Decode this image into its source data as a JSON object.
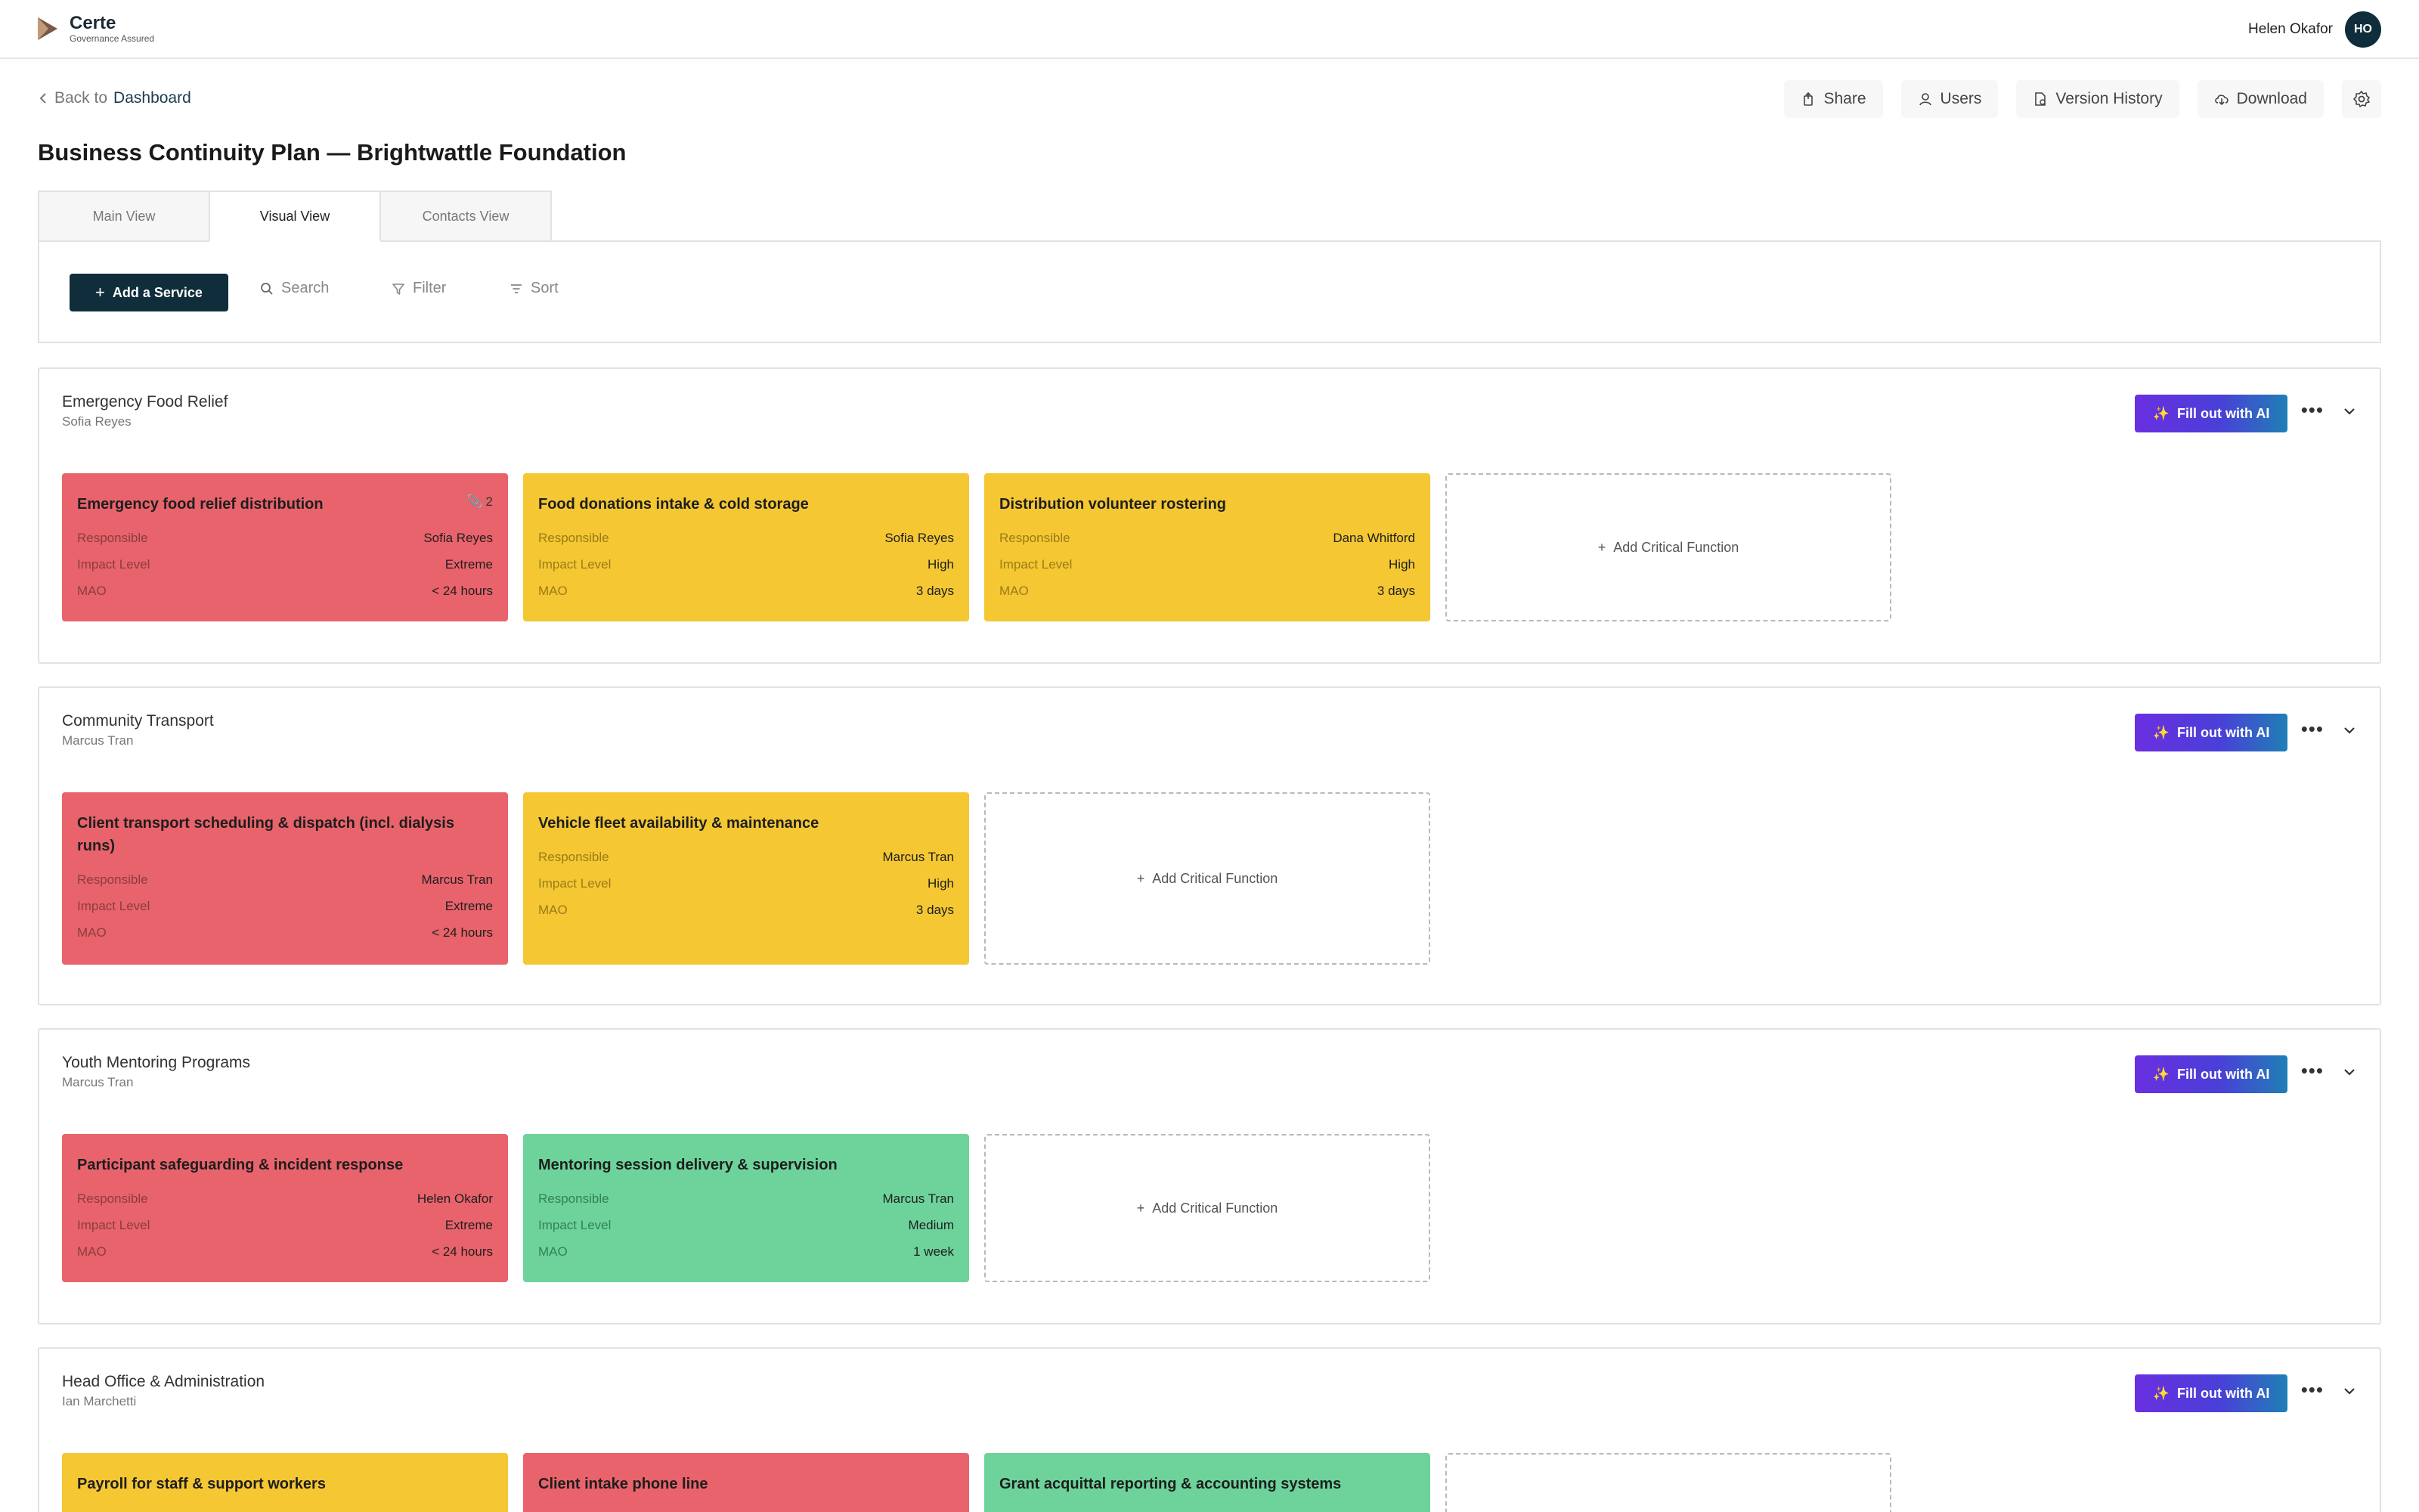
{
  "app": {
    "name": "Certe",
    "tagline": "Governance Assured"
  },
  "user": {
    "name": "Helen Okafor",
    "initials": "HO"
  },
  "nav": {
    "back_prefix": "Back to",
    "back_link": "Dashboard"
  },
  "actions": {
    "share": "Share",
    "users": "Users",
    "version_history": "Version History",
    "download": "Download",
    "settings_icon": "gear-icon"
  },
  "page": {
    "title": "Business Continuity Plan — Brightwattle Foundation"
  },
  "tabs": [
    {
      "label": "Main View"
    },
    {
      "label": "Visual View"
    },
    {
      "label": "Contacts View"
    }
  ],
  "active_tab": "Visual View",
  "toolbar": {
    "add_service": "Add a Service",
    "search": "Search",
    "filter": "Filter",
    "sort": "Sort"
  },
  "labels": {
    "responsible": "Responsible",
    "impact": "Impact Level",
    "mao": "MAO",
    "fill_ai": "Fill out with AI",
    "add_cf": "Add Critical Function"
  },
  "colors": {
    "extreme": "#e8636b",
    "high": "#f4c733",
    "medium": "#6dd39b",
    "primary": "#0f2d3a"
  },
  "services": [
    {
      "name": "Emergency Food Relief",
      "owner": "Sofia Reyes",
      "functions": [
        {
          "title": "Emergency food relief distribution",
          "attachments": "2",
          "responsible": "Sofia Reyes",
          "impact": "Extreme",
          "mao": "< 24 hours"
        },
        {
          "title": "Food donations intake & cold storage",
          "responsible": "Sofia Reyes",
          "impact": "High",
          "mao": "3 days"
        },
        {
          "title": "Distribution volunteer rostering",
          "responsible": "Dana Whitford",
          "impact": "High",
          "mao": "3 days"
        }
      ]
    },
    {
      "name": "Community Transport",
      "owner": "Marcus Tran",
      "functions": [
        {
          "title": "Client transport scheduling & dispatch (incl. dialysis runs)",
          "responsible": "Marcus Tran",
          "impact": "Extreme",
          "mao": "< 24 hours"
        },
        {
          "title": "Vehicle fleet availability & maintenance",
          "responsible": "Marcus Tran",
          "impact": "High",
          "mao": "3 days"
        }
      ]
    },
    {
      "name": "Youth Mentoring Programs",
      "owner": "Marcus Tran",
      "functions": [
        {
          "title": "Participant safeguarding & incident response",
          "responsible": "Helen Okafor",
          "impact": "Extreme",
          "mao": "< 24 hours"
        },
        {
          "title": "Mentoring session delivery & supervision",
          "responsible": "Marcus Tran",
          "impact": "Medium",
          "mao": "1 week"
        }
      ]
    },
    {
      "name": "Head Office & Administration",
      "owner": "Ian Marchetti",
      "functions": [
        {
          "title": "Payroll for staff & support workers",
          "impact": "High"
        },
        {
          "title": "Client intake phone line",
          "impact": "Extreme"
        },
        {
          "title": "Grant acquittal reporting & accounting systems",
          "impact": "Medium"
        }
      ]
    }
  ]
}
